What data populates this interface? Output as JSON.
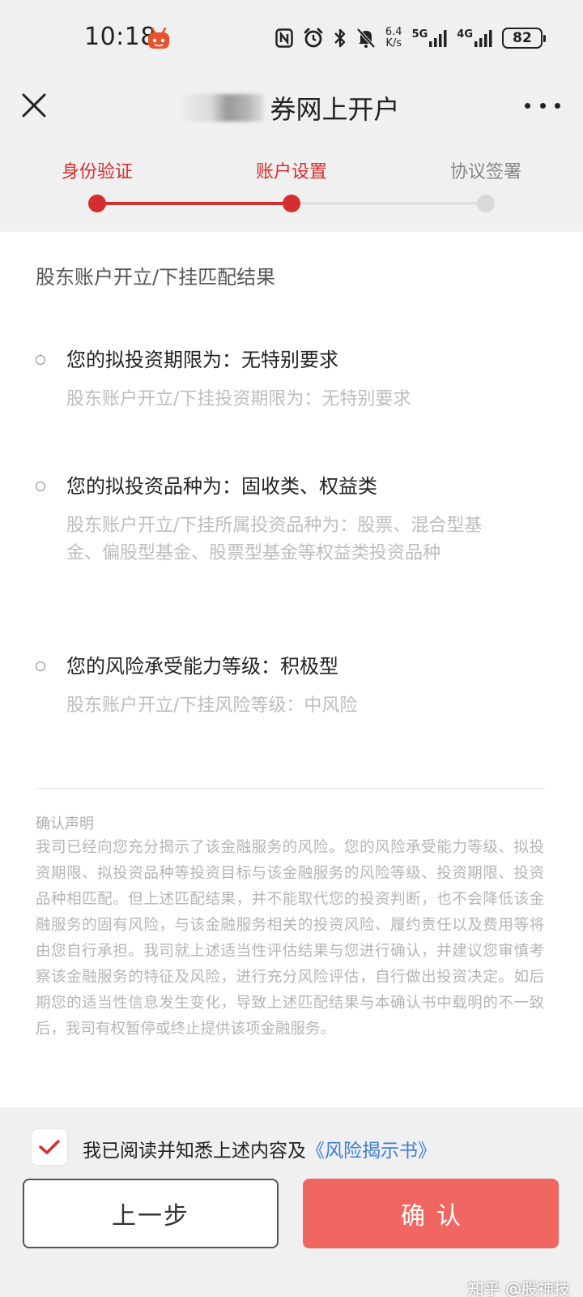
{
  "status_bar": {
    "time": "10:18",
    "net_speed_value": "6.4",
    "net_speed_unit": "K/s",
    "network_1": "5G",
    "network_2": "4G",
    "battery": "82"
  },
  "nav": {
    "title": "券网上开户"
  },
  "steps": [
    {
      "label": "身份验证",
      "state": "done"
    },
    {
      "label": "账户设置",
      "state": "current"
    },
    {
      "label": "协议签署",
      "state": "pending"
    }
  ],
  "content": {
    "section_title": "股东账户开立/下挂匹配结果",
    "items": [
      {
        "main": "您的拟投资期限为：无特别要求",
        "sub": "股东账户开立/下挂投资期限为：无特别要求"
      },
      {
        "main": "您的拟投资品种为：固收类、权益类",
        "sub": "股东账户开立/下挂所属投资品种为：股票、混合型基金、偏股型基金、股票型基金等权益类投资品种"
      },
      {
        "main": "您的风险承受能力等级：积极型",
        "sub": "股东账户开立/下挂风险等级：中风险"
      }
    ],
    "declaration_title": "确认声明",
    "declaration_text": "我司已经向您充分揭示了该金融服务的风险。您的风险承受能力等级、拟投资期限、拟投资品种等投资目标与该金融服务的风险等级、投资期限、投资品种相匹配。但上述匹配结果，并不能取代您的投资判断，也不会降低该金融服务的固有风险，与该金融服务相关的投资风险、履约责任以及费用等将由您自行承担。我司就上述适当性评估结果与您进行确认，并建议您审慎考察该金融服务的特征及风险，进行充分风险评估，自行做出投资决定。如后期您的适当性信息发生变化，导致上述匹配结果与本确认书中载明的不一致后，我司有权暂停或终止提供该项金融服务。"
  },
  "footer": {
    "agree_text": "我已阅读并知悉上述内容及",
    "agree_link": "《风险揭示书》",
    "agree_checked": true,
    "prev_label": "上一步",
    "confirm_label": "确认"
  },
  "watermark": "知乎 @股神技",
  "colors": {
    "accent": "#d32f2f",
    "confirm_button": "#ef6760",
    "link": "#3b7fd4"
  }
}
